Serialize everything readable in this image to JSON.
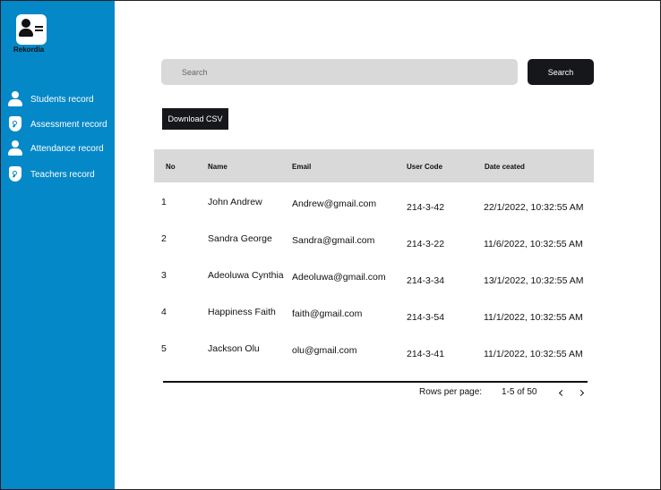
{
  "brand": {
    "name": "Rekordia",
    "logo_icon": "id-card-icon"
  },
  "sidebar": {
    "items": [
      {
        "label": "Students record",
        "icon": "person-icon"
      },
      {
        "label": "Assessment record",
        "icon": "shield-search-icon"
      },
      {
        "label": "Attendance record",
        "icon": "person-icon"
      },
      {
        "label": "Teachers record",
        "icon": "shield-search-icon"
      }
    ]
  },
  "search": {
    "placeholder": "Search",
    "button_label": "Search"
  },
  "actions": {
    "download_csv_label": "Download CSV"
  },
  "table": {
    "columns": [
      "No",
      "Name",
      "Email",
      "User Code",
      "Date ceated"
    ],
    "rows": [
      {
        "no": "1",
        "name": "John Andrew",
        "email": "Andrew@gmail.com",
        "code": "214-3-42",
        "date": "22/1/2022, 10:32:55 AM"
      },
      {
        "no": "2",
        "name": "Sandra George",
        "email": "Sandra@gmail.com",
        "code": "214-3-22",
        "date": "11/6/2022, 10:32:55 AM"
      },
      {
        "no": "3",
        "name": "Adeoluwa Cynthia",
        "email": "Adeoluwa@gmail.com",
        "code": "214-3-34",
        "date": "13/1/2022, 10:32:55 AM"
      },
      {
        "no": "4",
        "name": "Happiness Faith",
        "email": "faith@gmail.com",
        "code": "214-3-54",
        "date": "11/1/2022, 10:32:55 AM"
      },
      {
        "no": "5",
        "name": "Jackson Olu",
        "email": "olu@gmail.com",
        "code": "214-3-41",
        "date": "11/1/2022, 10:32:55 AM"
      }
    ]
  },
  "pagination": {
    "rows_per_page_label": "Rows per page:",
    "range_label": "1-5 of 50"
  },
  "colors": {
    "sidebar": "#0588c8",
    "button": "#15171a",
    "header_bg": "#d9d9d9"
  }
}
